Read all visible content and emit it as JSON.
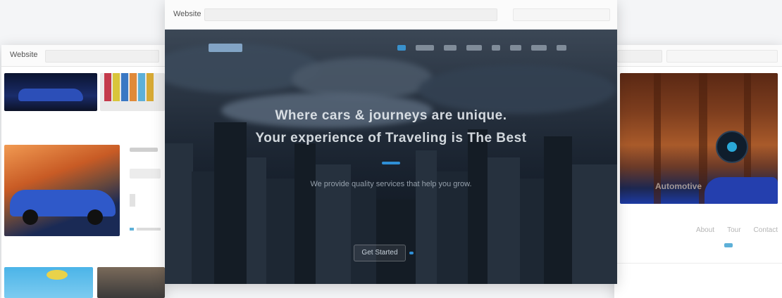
{
  "windows": {
    "left": {
      "title": "Website"
    },
    "center": {
      "title": "Website",
      "hero": {
        "headline_1": "Where cars & journeys are unique.",
        "headline_2": "Your experience of Traveling is The Best",
        "sub_text": "We provide quality services that help you grow.",
        "cta_label": "Get Started"
      }
    },
    "right": {
      "title": "",
      "banner_text": "Automotive",
      "links": [
        "About",
        "Tour",
        "Contact"
      ]
    }
  },
  "colors": {
    "accent": "#2f8fd6",
    "hero_dark": "#1b2530",
    "car_blue": "#2744a8",
    "wood": "#8a4a2a"
  }
}
